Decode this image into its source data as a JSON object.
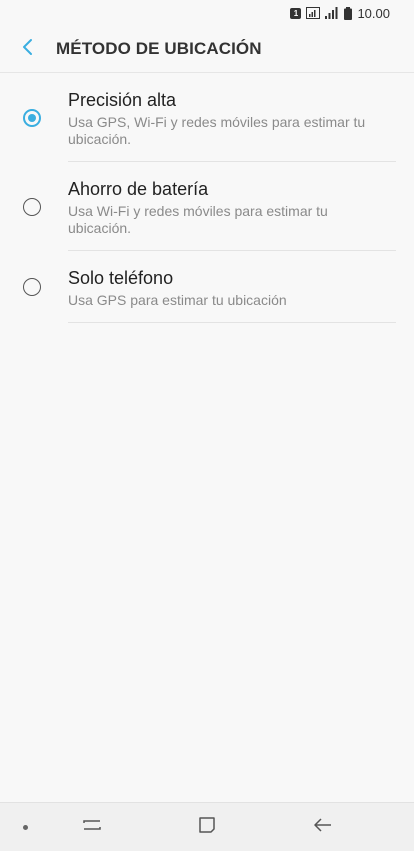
{
  "status_bar": {
    "sim": "1",
    "time": "10.00"
  },
  "header": {
    "back_icon": "chevron-left-icon",
    "title": "MÉTODO DE UBICACIÓN"
  },
  "options": [
    {
      "title": "Precisión alta",
      "description": "Usa GPS, Wi-Fi y redes móviles para estimar tu ubicación.",
      "selected": true
    },
    {
      "title": "Ahorro de batería",
      "description": "Usa Wi-Fi y redes móviles para estimar tu ubicación.",
      "selected": false
    },
    {
      "title": "Solo teléfono",
      "description": "Usa GPS para estimar tu ubicación",
      "selected": false
    }
  ],
  "colors": {
    "accent": "#3aaee0",
    "background": "#f8f8f8"
  },
  "nav_bar": {
    "icons": [
      "dot-icon",
      "recent-apps-icon",
      "home-icon",
      "back-arrow-icon"
    ]
  }
}
